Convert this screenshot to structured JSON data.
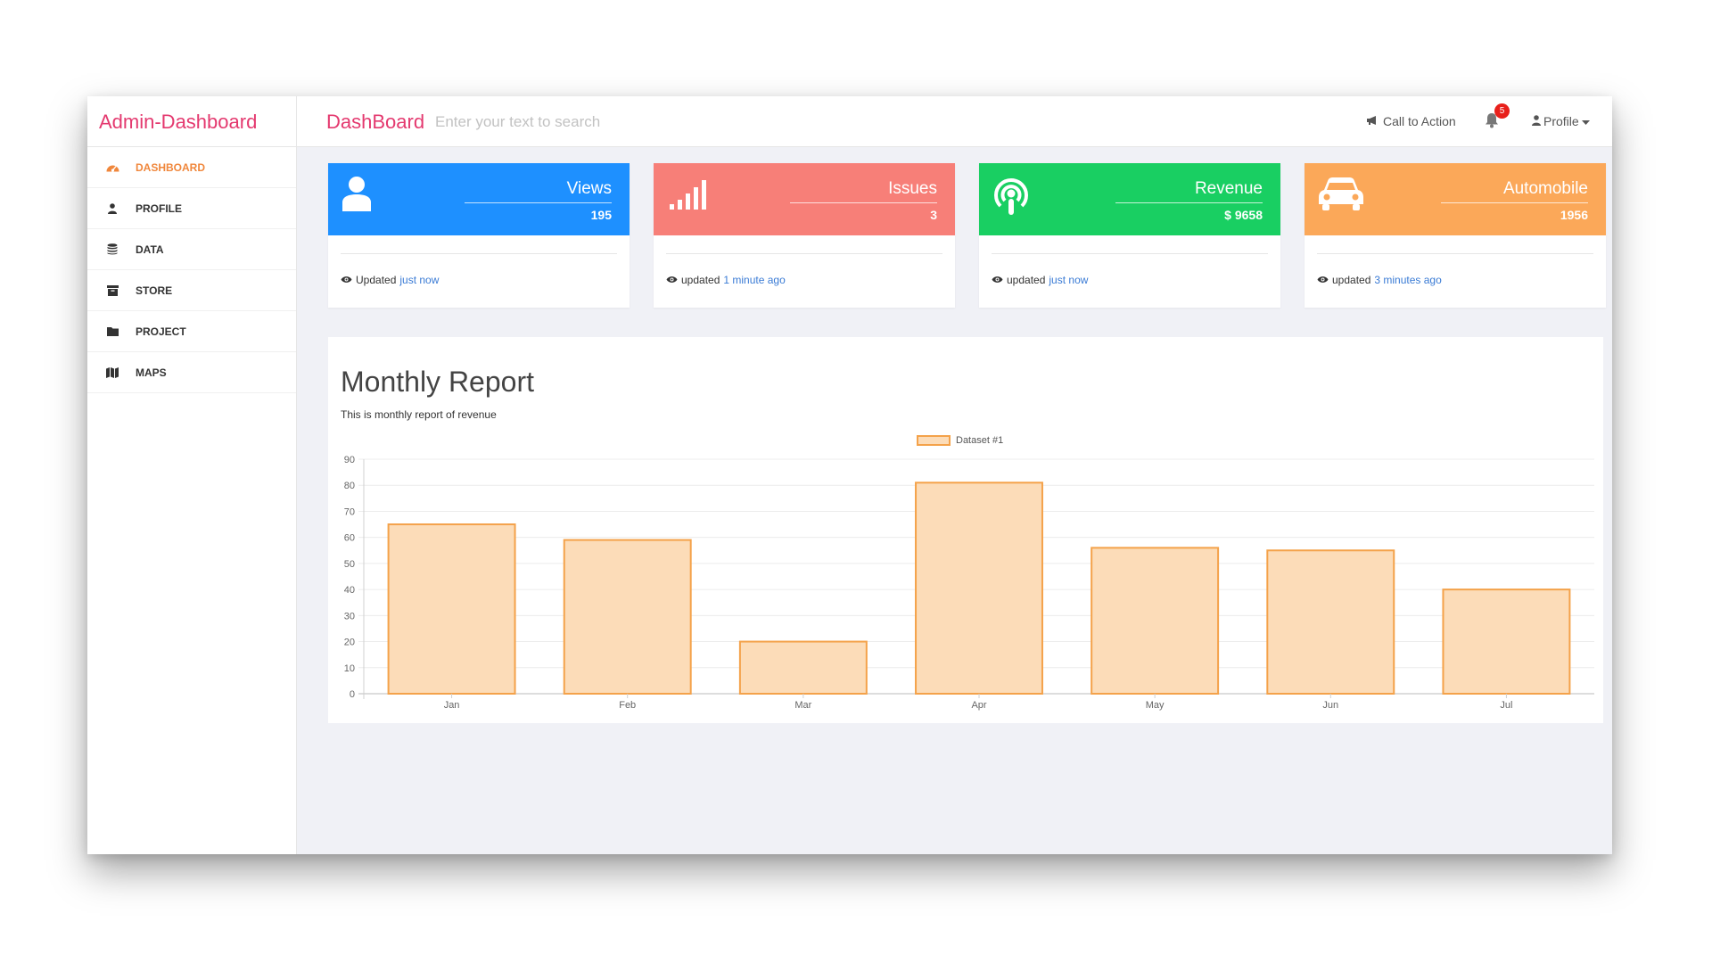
{
  "header": {
    "brand": "Admin-Dashboard",
    "page_title": "DashBoard",
    "search_placeholder": "Enter your text to search",
    "cta_label": "Call to Action",
    "notification_count": "5",
    "profile_label": "Profile"
  },
  "sidebar": {
    "items": [
      {
        "label": "DASHBOARD",
        "icon": "dashboard-icon",
        "active": true
      },
      {
        "label": "PROFILE",
        "icon": "user-icon"
      },
      {
        "label": "DATA",
        "icon": "database-icon"
      },
      {
        "label": "STORE",
        "icon": "archive-icon"
      },
      {
        "label": "PROJECT",
        "icon": "folder-icon"
      },
      {
        "label": "MAPS",
        "icon": "map-icon"
      }
    ]
  },
  "cards": [
    {
      "title": "Views",
      "value": "195",
      "updated_prefix": "Updated",
      "updated_when": "just now",
      "color": "#1e90ff",
      "icon": "user-icon"
    },
    {
      "title": "Issues",
      "value": "3",
      "updated_prefix": "updated",
      "updated_when": "1 minute ago",
      "color": "#f77f78",
      "icon": "signal-icon"
    },
    {
      "title": "Revenue",
      "value": "$ 9658",
      "updated_prefix": "updated",
      "updated_when": "just now",
      "color": "#19cf62",
      "icon": "podcast-icon"
    },
    {
      "title": "Automobile",
      "value": "1956",
      "updated_prefix": "updated",
      "updated_when": "3 minutes ago",
      "color": "#fba859",
      "icon": "car-icon"
    }
  ],
  "report": {
    "title": "Monthly Report",
    "subtitle": "This is monthly report of revenue"
  },
  "chart_data": {
    "type": "bar",
    "categories": [
      "Jan",
      "Feb",
      "Mar",
      "Apr",
      "May",
      "Jun",
      "Jul"
    ],
    "series": [
      {
        "name": "Dataset #1",
        "values": [
          65,
          59,
          20,
          81,
          56,
          55,
          40
        ]
      }
    ],
    "ylim": [
      0,
      90
    ],
    "yticks": [
      0,
      10,
      20,
      30,
      40,
      50,
      60,
      70,
      80,
      90
    ],
    "grid": true,
    "legend": "top-center",
    "bar_fill": "#fcdcb8",
    "bar_stroke": "#f4a24a"
  }
}
